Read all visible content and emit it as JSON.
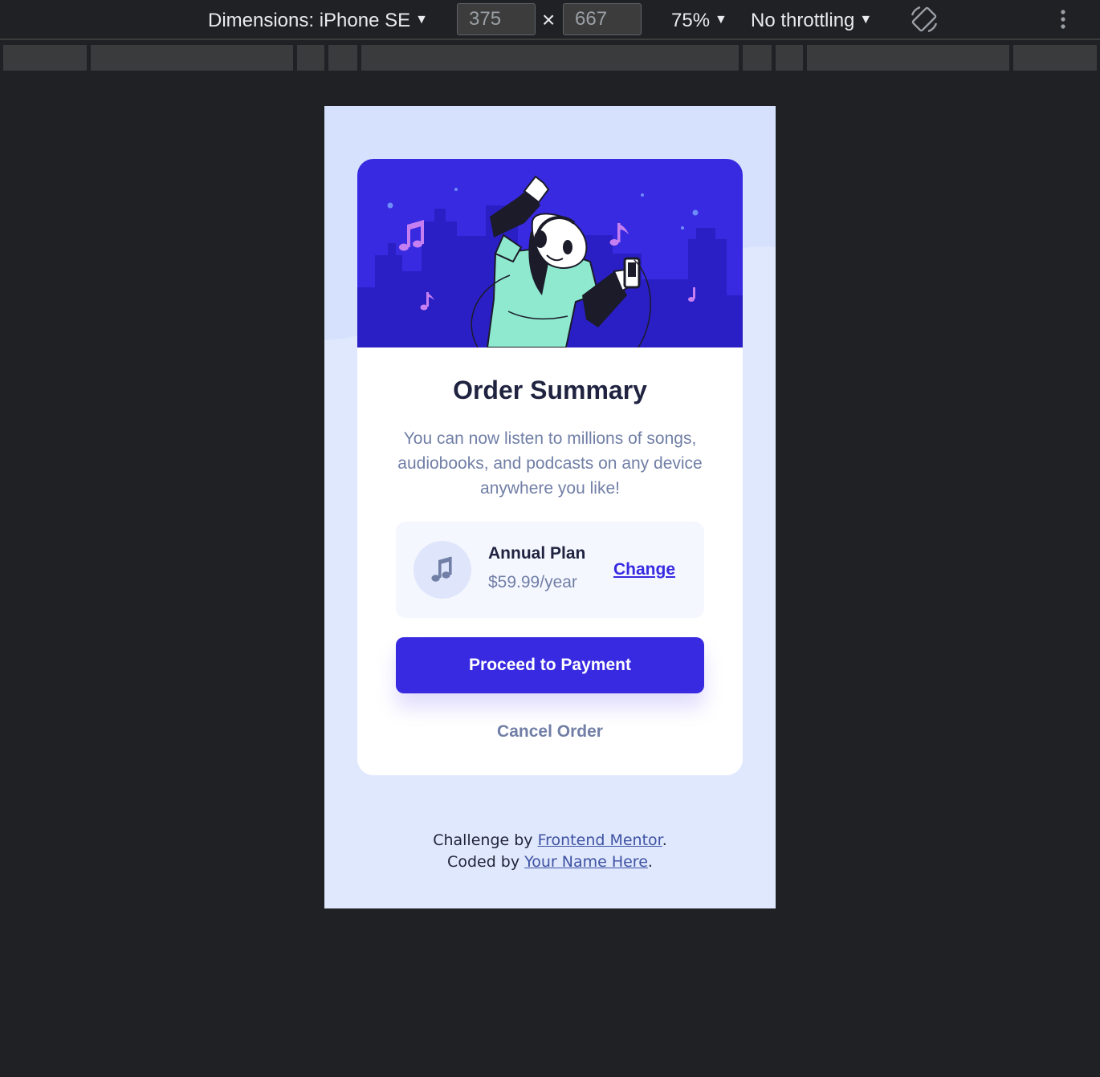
{
  "devtools": {
    "dimensions_label": "Dimensions: iPhone SE",
    "width_value": "375",
    "times_symbol": "×",
    "height_value": "667",
    "zoom_label": "75%",
    "throttling_label": "No throttling",
    "caret": "▼",
    "icons": [
      "rotate-icon",
      "kebab-menu-icon"
    ]
  },
  "card": {
    "title": "Order Summary",
    "description": "You can now listen to millions of songs, audiobooks, and podcasts on any device anywhere you like!",
    "plan": {
      "icon": "music-note-icon",
      "name": "Annual Plan",
      "price": "$59.99/year",
      "change_label": "Change"
    },
    "pay_label": "Proceed to Payment",
    "cancel_label": "Cancel Order"
  },
  "attribution": {
    "challenge_prefix": "Challenge by ",
    "challenge_link": "Frontend Mentor",
    "challenge_suffix": ".",
    "coded_prefix": "Coded by ",
    "coded_link": "Your Name Here",
    "coded_suffix": "."
  },
  "colors": {
    "page_background": "#e0e8fd",
    "hero_background": "#382ae1",
    "primary_button": "#382ae1",
    "muted_text": "#717fa6",
    "dark_text": "#1f2340",
    "devtools_background": "#202124"
  }
}
